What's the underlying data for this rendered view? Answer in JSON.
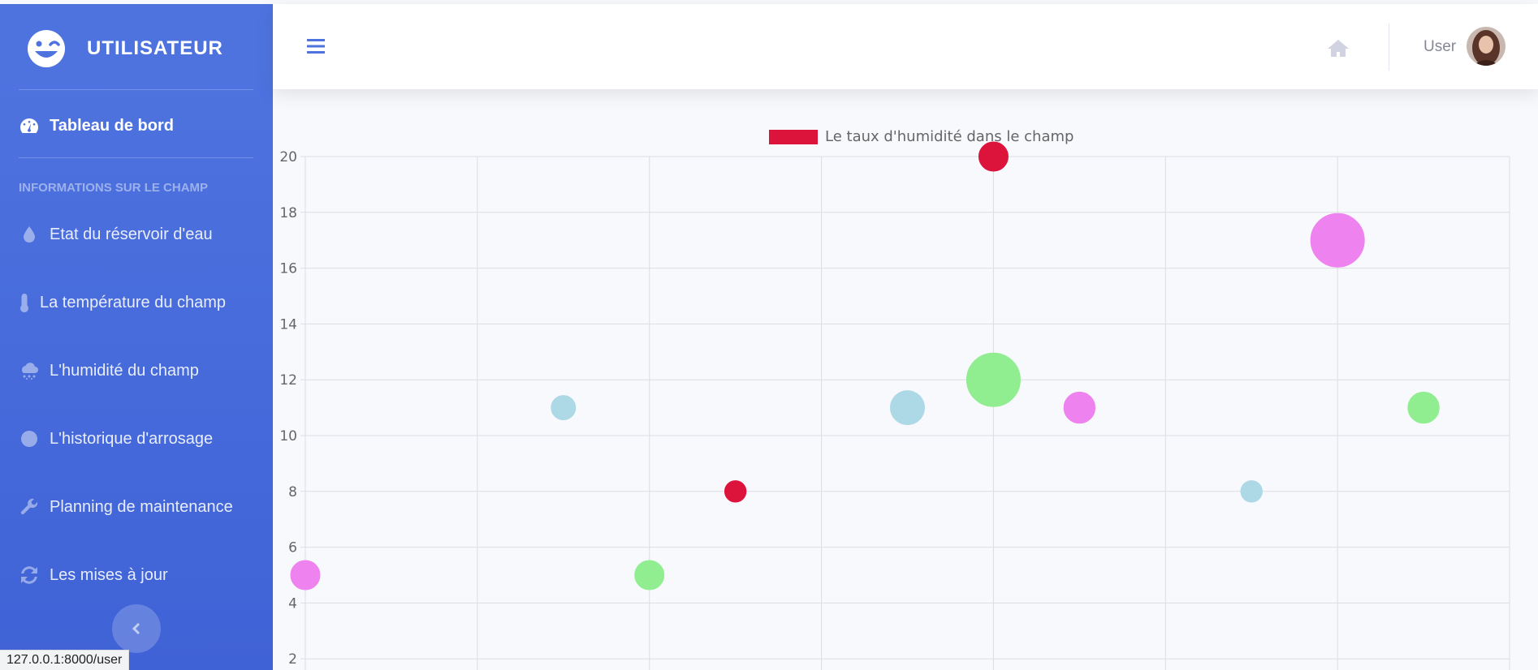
{
  "sidebar": {
    "brand": "UTILISATEUR",
    "dashboard_label": "Tableau de bord",
    "section_heading": "INFORMATIONS SUR LE CHAMP",
    "items": [
      {
        "label": "Etat du réservoir d'eau",
        "icon": "water-drop-icon"
      },
      {
        "label": "La température du champ",
        "icon": "thermometer-icon"
      },
      {
        "label": "L'humidité du champ",
        "icon": "cloud-rain-icon"
      },
      {
        "label": "L'historique d'arrosage",
        "icon": "clock-icon"
      },
      {
        "label": "Planning de maintenance",
        "icon": "wrench-icon"
      },
      {
        "label": "Les mises à jour",
        "icon": "sync-icon"
      }
    ]
  },
  "topbar": {
    "user_name": "User"
  },
  "status_bar_url": "127.0.0.1:8000/user",
  "colors": {
    "sidebar": "#4e73df",
    "red": "#dc143c",
    "violet": "#ee82ee",
    "lightblue": "#add8e6",
    "lightgreen": "#90ee90"
  },
  "chart_data": {
    "type": "bubble",
    "legend": [
      {
        "label": "Le taux d'humidité dans le champ",
        "color": "#dc143c"
      }
    ],
    "y_ticks": [
      2,
      4,
      6,
      8,
      10,
      12,
      14,
      16,
      18,
      20
    ],
    "ylim": [
      2,
      20
    ],
    "xlim": [
      0,
      7
    ],
    "grid": true,
    "points": [
      {
        "x": 0.0,
        "y": 5,
        "r": 3,
        "color": "#ee82ee"
      },
      {
        "x": 1.5,
        "y": 11,
        "r": 2.5,
        "color": "#add8e6"
      },
      {
        "x": 2.0,
        "y": 5,
        "r": 3,
        "color": "#90ee90"
      },
      {
        "x": 2.5,
        "y": 8,
        "r": 2.2,
        "color": "#dc143c"
      },
      {
        "x": 3.5,
        "y": 11,
        "r": 3.5,
        "color": "#add8e6"
      },
      {
        "x": 4.0,
        "y": 20,
        "r": 3,
        "color": "#dc143c"
      },
      {
        "x": 4.0,
        "y": 12,
        "r": 5.5,
        "color": "#90ee90"
      },
      {
        "x": 4.5,
        "y": 11,
        "r": 3.2,
        "color": "#ee82ee"
      },
      {
        "x": 5.5,
        "y": 8,
        "r": 2.2,
        "color": "#add8e6"
      },
      {
        "x": 6.0,
        "y": 17,
        "r": 5.5,
        "color": "#ee82ee"
      },
      {
        "x": 6.5,
        "y": 11,
        "r": 3.2,
        "color": "#90ee90"
      }
    ]
  }
}
